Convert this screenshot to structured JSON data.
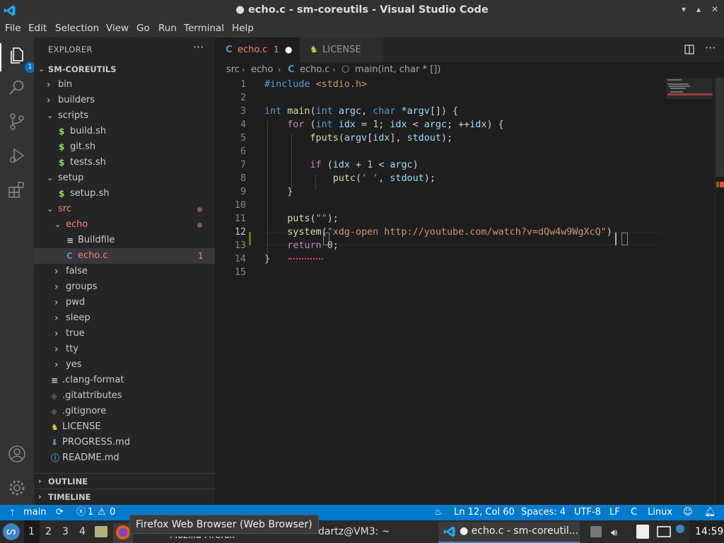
{
  "window": {
    "title": "● echo.c - sm-coreutils - Visual Studio Code",
    "controls": [
      "▾",
      "▴",
      "✕"
    ]
  },
  "menu": [
    "File",
    "Edit",
    "Selection",
    "View",
    "Go",
    "Run",
    "Terminal",
    "Help"
  ],
  "activity_bar": {
    "explorer_badge": "1",
    "items": [
      "explorer-icon",
      "search-icon",
      "source-control-icon",
      "run-debug-icon",
      "extensions-icon",
      "account-icon",
      "settings-gear-icon"
    ]
  },
  "explorer": {
    "header": "EXPLORER",
    "more": "···",
    "root": "SM-COREUTILS",
    "tree": [
      {
        "label": "bin",
        "kind": "folder",
        "depth": 1,
        "open": false
      },
      {
        "label": "builders",
        "kind": "folder",
        "depth": 1,
        "open": false
      },
      {
        "label": "scripts",
        "kind": "folder",
        "depth": 1,
        "open": true
      },
      {
        "label": "build.sh",
        "kind": "shell",
        "depth": 2,
        "icon": "$"
      },
      {
        "label": "git.sh",
        "kind": "shell",
        "depth": 2,
        "icon": "$"
      },
      {
        "label": "tests.sh",
        "kind": "shell",
        "depth": 2,
        "icon": "$"
      },
      {
        "label": "setup",
        "kind": "folder",
        "depth": 1,
        "open": true
      },
      {
        "label": "setup.sh",
        "kind": "shell",
        "depth": 2,
        "icon": "$"
      },
      {
        "label": "src",
        "kind": "folder",
        "depth": 1,
        "open": true,
        "modified": true,
        "color": "#f48771"
      },
      {
        "label": "echo",
        "kind": "folder",
        "depth": 2,
        "open": true,
        "modified": true,
        "color": "#f48771"
      },
      {
        "label": "Buildfile",
        "kind": "file",
        "depth": 3,
        "icon": "≡"
      },
      {
        "label": "echo.c",
        "kind": "c",
        "depth": 3,
        "icon": "C",
        "selected": true,
        "problems": "1",
        "color": "#f48771"
      },
      {
        "label": "false",
        "kind": "folder",
        "depth": 2,
        "open": false
      },
      {
        "label": "groups",
        "kind": "folder",
        "depth": 2,
        "open": false
      },
      {
        "label": "pwd",
        "kind": "folder",
        "depth": 2,
        "open": false
      },
      {
        "label": "sleep",
        "kind": "folder",
        "depth": 2,
        "open": false
      },
      {
        "label": "true",
        "kind": "folder",
        "depth": 2,
        "open": false
      },
      {
        "label": "tty",
        "kind": "folder",
        "depth": 2,
        "open": false
      },
      {
        "label": "yes",
        "kind": "folder",
        "depth": 2,
        "open": false
      },
      {
        "label": ".clang-format",
        "kind": "file",
        "depth": 1,
        "icon": "≡"
      },
      {
        "label": ".gitattributes",
        "kind": "git",
        "depth": 1,
        "icon": "◆"
      },
      {
        "label": ".gitignore",
        "kind": "git",
        "depth": 1,
        "icon": "◆"
      },
      {
        "label": "LICENSE",
        "kind": "license",
        "depth": 1,
        "icon": "♞"
      },
      {
        "label": "PROGRESS.md",
        "kind": "md",
        "depth": 1,
        "icon": "⬇"
      },
      {
        "label": "README.md",
        "kind": "info",
        "depth": 1,
        "icon": "ⓘ"
      }
    ],
    "outline": "OUTLINE",
    "timeline": "TIMELINE"
  },
  "tabs": [
    {
      "label": "echo.c",
      "icon": "C",
      "problems": "1",
      "dirty": "●",
      "active": true
    },
    {
      "label": "LICENSE",
      "icon": "♞",
      "active": false
    }
  ],
  "breadcrumb": [
    "src",
    "echo",
    "echo.c",
    "main(int, char * [])"
  ],
  "code": {
    "current_line": 12,
    "lines": [
      [
        [
          "kw",
          "#include "
        ],
        [
          "str",
          "<stdio.h>"
        ]
      ],
      [],
      [
        [
          "kw",
          "int "
        ],
        [
          "fn",
          "main"
        ],
        [
          "pl",
          "("
        ],
        [
          "kw",
          "int "
        ],
        [
          "var",
          "argc"
        ],
        [
          "pl",
          ", "
        ],
        [
          "kw",
          "char "
        ],
        [
          "pl",
          "*"
        ],
        [
          "var",
          "argv"
        ],
        [
          "pl",
          "[]) {"
        ]
      ],
      [
        [
          "pl",
          "    "
        ],
        [
          "ctrl",
          "for "
        ],
        [
          "pl",
          "("
        ],
        [
          "kw",
          "int "
        ],
        [
          "var",
          "idx"
        ],
        [
          "pl",
          " = "
        ],
        [
          "num",
          "1"
        ],
        [
          "pl",
          "; "
        ],
        [
          "var",
          "idx"
        ],
        [
          "pl",
          " < "
        ],
        [
          "var",
          "argc"
        ],
        [
          "pl",
          "; ++"
        ],
        [
          "var",
          "idx"
        ],
        [
          "pl",
          ") {"
        ]
      ],
      [
        [
          "pl",
          "        "
        ],
        [
          "fn",
          "fputs"
        ],
        [
          "pl",
          "("
        ],
        [
          "var",
          "argv"
        ],
        [
          "pl",
          "["
        ],
        [
          "var",
          "idx"
        ],
        [
          "pl",
          "], "
        ],
        [
          "var",
          "stdout"
        ],
        [
          "pl",
          ");"
        ]
      ],
      [],
      [
        [
          "pl",
          "        "
        ],
        [
          "ctrl",
          "if "
        ],
        [
          "pl",
          "("
        ],
        [
          "var",
          "idx"
        ],
        [
          "pl",
          " + "
        ],
        [
          "num",
          "1"
        ],
        [
          "pl",
          " < "
        ],
        [
          "var",
          "argc"
        ],
        [
          "pl",
          ")"
        ]
      ],
      [
        [
          "pl",
          "            "
        ],
        [
          "fn",
          "putc"
        ],
        [
          "pl",
          "("
        ],
        [
          "str",
          "' '"
        ],
        [
          "pl",
          ", "
        ],
        [
          "var",
          "stdout"
        ],
        [
          "pl",
          ");"
        ]
      ],
      [
        [
          "pl",
          "    }"
        ]
      ],
      [],
      [
        [
          "pl",
          "    "
        ],
        [
          "fn",
          "puts"
        ],
        [
          "pl",
          "("
        ],
        [
          "str",
          "\"\""
        ],
        [
          "pl",
          ");"
        ]
      ],
      [
        [
          "pl",
          "    "
        ],
        [
          "fn",
          "system"
        ],
        [
          "pl",
          "("
        ],
        [
          "str",
          "\"xdg-open http://youtube.com/watch?v=dQw4w9WgXcQ\""
        ],
        [
          "pl",
          ")"
        ]
      ],
      [
        [
          "pl",
          "    "
        ],
        [
          "ctrl",
          "return "
        ],
        [
          "num",
          "0"
        ],
        [
          "pl",
          ";"
        ]
      ],
      [
        [
          "pl",
          "}"
        ]
      ],
      []
    ]
  },
  "status": {
    "branch": "main",
    "errors": "1",
    "warnings": "0",
    "position": "Ln 12, Col 60",
    "indent": "Spaces: 4",
    "encoding": "UTF-8",
    "eol": "LF",
    "language": "C",
    "os": "Linux"
  },
  "taskbar": {
    "workspaces": [
      "1",
      "2",
      "3",
      "4"
    ],
    "terminal_label": "dartz@VM3: ~",
    "vscode_label": "● echo.c - sm-coreutil...",
    "clock": "14:59",
    "tooltip": "Firefox Web Browser (Web Browser)",
    "hidden_label": "Mozilla Firefox"
  },
  "colors": {
    "accent": "#007acc",
    "error": "#f48771",
    "modified_dot": "#8a5a58"
  }
}
